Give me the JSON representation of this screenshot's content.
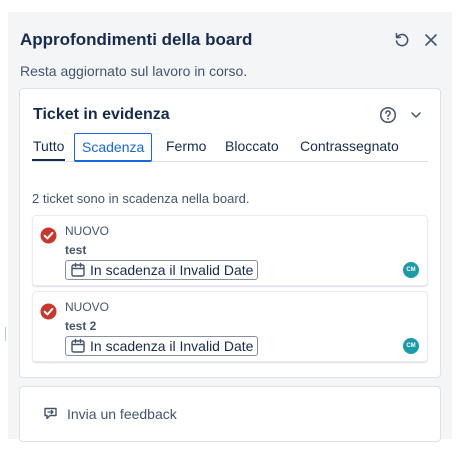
{
  "panel": {
    "title": "Approfondimenti della board",
    "subtitle": "Resta aggiornato sul lavoro in corso."
  },
  "card": {
    "title": "Ticket in evidenza",
    "tabs": [
      {
        "label": "Tutto"
      },
      {
        "label": "Scadenza"
      },
      {
        "label": "Fermo"
      },
      {
        "label": "Bloccato"
      },
      {
        "label": "Contrassegnato"
      }
    ],
    "selected_tab": "Scadenza",
    "summary": "2 ticket sono in scadenza nella board."
  },
  "tickets": [
    {
      "status": "NUOVO",
      "name": "test",
      "due": "In scadenza il Invalid Date",
      "assignee": "CM"
    },
    {
      "status": "NUOVO",
      "name": "test 2",
      "due": "In scadenza il Invalid Date",
      "assignee": "CM"
    }
  ],
  "feedback": {
    "label": "Invia un feedback"
  },
  "icons": {
    "refresh": "refresh-icon",
    "close": "close-icon",
    "help": "help-icon",
    "chevron": "chevron-down-icon",
    "status": "check-circle-icon",
    "calendar": "calendar-icon",
    "feedback": "feedback-icon"
  },
  "colors": {
    "accent": "#1868db",
    "status_red": "#c9372c",
    "avatar": "#1b9aa8"
  }
}
